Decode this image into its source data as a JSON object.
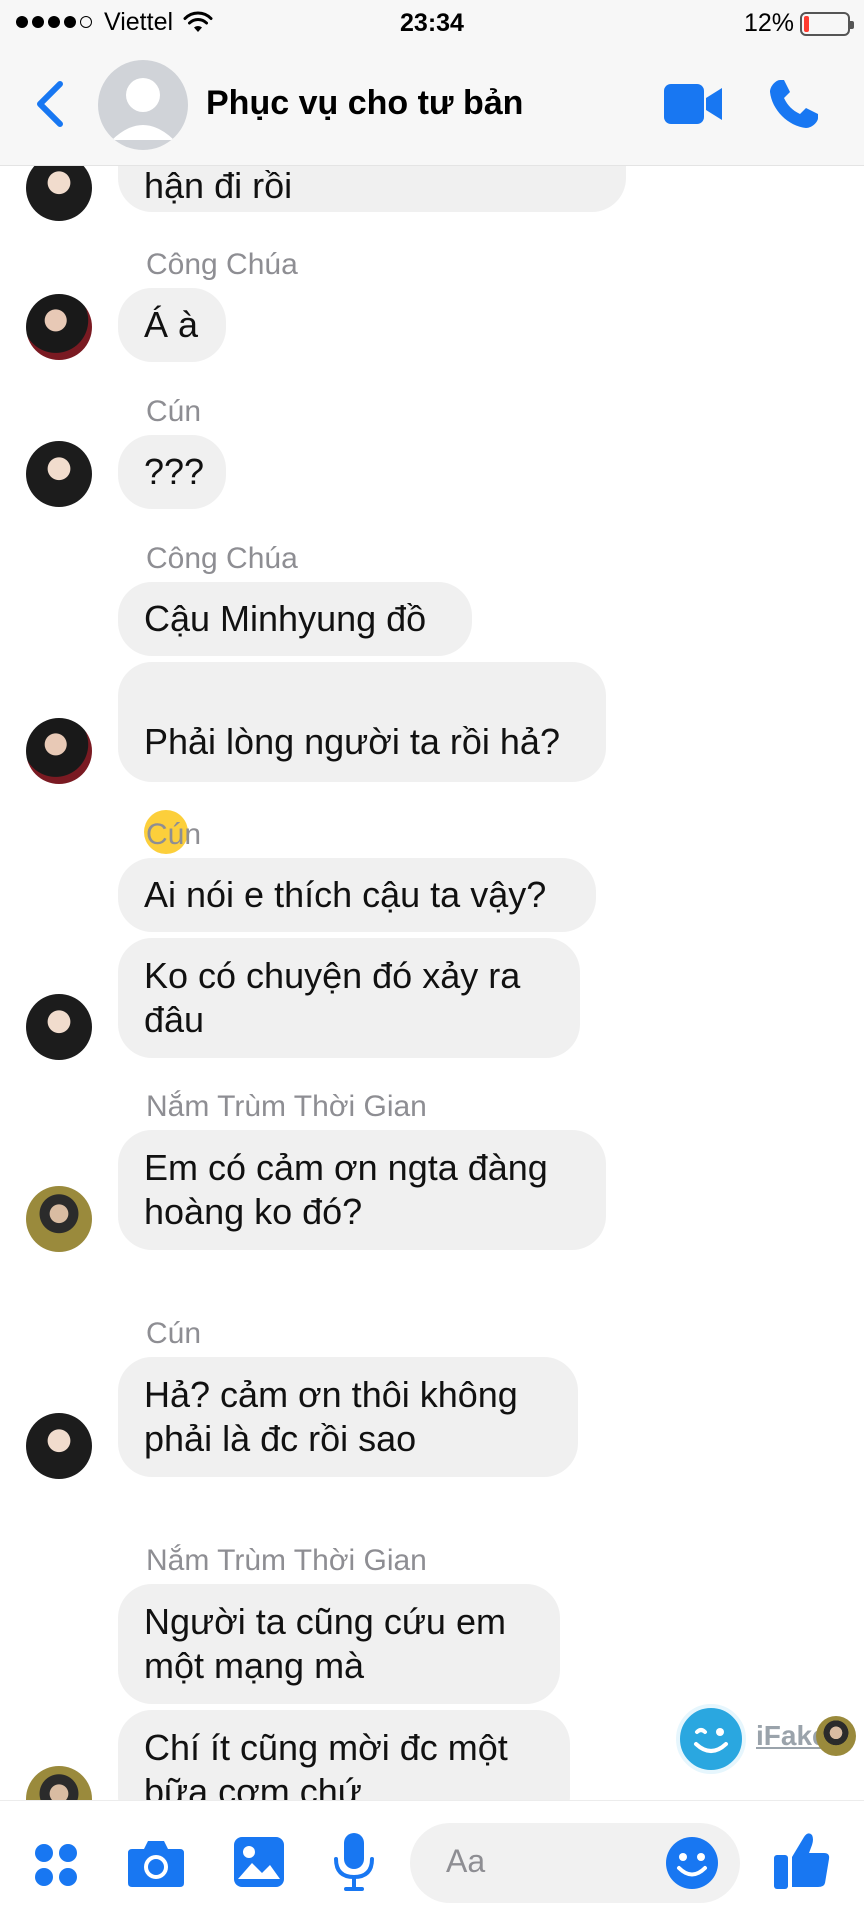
{
  "status_bar": {
    "carrier": "Viettel",
    "signal_bars_filled": 4,
    "signal_bars_total": 5,
    "time": "23:34",
    "battery_percent": "12%",
    "battery_level": 0.12
  },
  "header": {
    "title": "Phục vụ cho tư bản",
    "icons": [
      "back-chevron-icon",
      "video-call-icon",
      "phone-call-icon"
    ]
  },
  "messages": {
    "partial_top": "hận đi rồi",
    "groups": [
      {
        "sender": "Công Chúa",
        "avatar": "cong",
        "bubbles": [
          "Á à"
        ]
      },
      {
        "sender": "Cún",
        "avatar": "cun",
        "bubbles": [
          "???"
        ]
      },
      {
        "sender": "Công Chúa",
        "avatar": "cong",
        "bubbles": [
          "Cậu Minhyung đồ",
          "Phải lòng người ta rồi hả?"
        ]
      },
      {
        "sender": "Cún",
        "avatar": "cun",
        "bubbles": [
          "Ai nói e thích cậu ta vậy?",
          "Ko có chuyện đó xảy ra\nđâu"
        ]
      },
      {
        "sender": "Nắm Trùm Thời Gian",
        "avatar": "nam",
        "bubbles": [
          "Em có cảm ơn ngta đàng\nhoàng ko đó?"
        ]
      },
      {
        "sender": "Cún",
        "avatar": "cun",
        "bubbles": [
          "Hả? cảm ơn thôi không\nphải là đc rồi sao"
        ]
      },
      {
        "sender": "Nắm Trùm Thời Gian",
        "avatar": "nam",
        "bubbles": [
          "Người ta cũng cứu em\nmột mạng mà",
          "Chí ít cũng mời đc một\nbữa cơm chứ"
        ]
      }
    ]
  },
  "watermark": {
    "text": "iFake"
  },
  "composer": {
    "placeholder": "Aa",
    "icons": [
      "apps-icon",
      "camera-icon",
      "gallery-icon",
      "microphone-icon",
      "emoji-icon",
      "like-icon"
    ]
  },
  "colors": {
    "accent": "#1877f2",
    "bubble": "#f0f0f0",
    "sender_text": "#8e8e93",
    "battery_low": "#ff3b30"
  }
}
